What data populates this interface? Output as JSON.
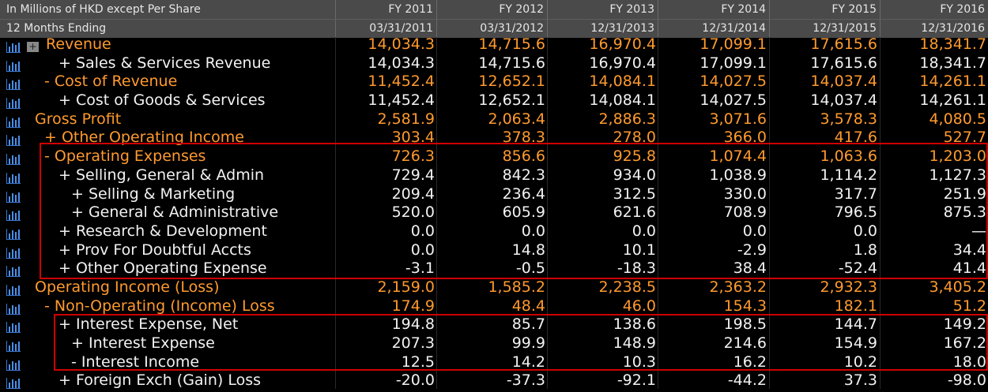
{
  "header": {
    "units": "In Millions of HKD except Per Share",
    "period": "12 Months Ending",
    "years": [
      "FY 2011",
      "FY 2012",
      "FY 2013",
      "FY 2014",
      "FY 2015",
      "FY 2016"
    ],
    "dates": [
      "03/31/2011",
      "03/31/2012",
      "12/31/2013",
      "12/31/2014",
      "12/31/2015",
      "12/31/2016"
    ]
  },
  "rows": [
    {
      "label": "Revenue",
      "indent": 0,
      "prefix": "",
      "color": "orange",
      "expand": true,
      "values": [
        "14,034.3",
        "14,715.6",
        "16,970.4",
        "17,099.1",
        "17,615.6",
        "18,341.7"
      ]
    },
    {
      "label": "+ Sales & Services Revenue",
      "indent": 2,
      "color": "white",
      "values": [
        "14,034.3",
        "14,715.6",
        "16,970.4",
        "17,099.1",
        "17,615.6",
        "18,341.7"
      ]
    },
    {
      "label": "- Cost of Revenue",
      "indent": 1,
      "color": "orange",
      "values": [
        "11,452.4",
        "12,652.1",
        "14,084.1",
        "14,027.5",
        "14,037.4",
        "14,261.1"
      ]
    },
    {
      "label": "+ Cost of Goods & Services",
      "indent": 2,
      "color": "white",
      "values": [
        "11,452.4",
        "12,652.1",
        "14,084.1",
        "14,027.5",
        "14,037.4",
        "14,261.1"
      ]
    },
    {
      "label": "Gross Profit",
      "indent": 0,
      "color": "orange",
      "values": [
        "2,581.9",
        "2,063.4",
        "2,886.3",
        "3,071.6",
        "3,578.3",
        "4,080.5"
      ]
    },
    {
      "label": "+ Other Operating Income",
      "indent": 1,
      "color": "orange",
      "values": [
        "303.4",
        "378.3",
        "278.0",
        "366.0",
        "417.6",
        "527.7"
      ]
    },
    {
      "label": "- Operating Expenses",
      "indent": 1,
      "color": "orange",
      "values": [
        "726.3",
        "856.6",
        "925.8",
        "1,074.4",
        "1,063.6",
        "1,203.0"
      ]
    },
    {
      "label": "+ Selling, General & Admin",
      "indent": 2,
      "color": "white",
      "values": [
        "729.4",
        "842.3",
        "934.0",
        "1,038.9",
        "1,114.2",
        "1,127.3"
      ]
    },
    {
      "label": "+ Selling & Marketing",
      "indent": 3,
      "color": "white",
      "values": [
        "209.4",
        "236.4",
        "312.5",
        "330.0",
        "317.7",
        "251.9"
      ]
    },
    {
      "label": "+ General & Administrative",
      "indent": 3,
      "color": "white",
      "values": [
        "520.0",
        "605.9",
        "621.6",
        "708.9",
        "796.5",
        "875.3"
      ]
    },
    {
      "label": "+ Research & Development",
      "indent": 2,
      "color": "white",
      "values": [
        "0.0",
        "0.0",
        "0.0",
        "0.0",
        "0.0",
        "—"
      ]
    },
    {
      "label": "+ Prov For Doubtful Accts",
      "indent": 2,
      "color": "white",
      "values": [
        "0.0",
        "14.8",
        "10.1",
        "-2.9",
        "1.8",
        "34.4"
      ]
    },
    {
      "label": "+ Other Operating Expense",
      "indent": 2,
      "color": "white",
      "values": [
        "-3.1",
        "-0.5",
        "-18.3",
        "38.4",
        "-52.4",
        "41.4"
      ]
    },
    {
      "label": "Operating Income (Loss)",
      "indent": 0,
      "color": "orange",
      "values": [
        "2,159.0",
        "1,585.2",
        "2,238.5",
        "2,363.2",
        "2,932.3",
        "3,405.2"
      ]
    },
    {
      "label": "- Non-Operating (Income) Loss",
      "indent": 1,
      "color": "orange",
      "values": [
        "174.9",
        "48.4",
        "46.0",
        "154.3",
        "182.1",
        "51.2"
      ]
    },
    {
      "label": "+ Interest Expense, Net",
      "indent": 2,
      "color": "white",
      "values": [
        "194.8",
        "85.7",
        "138.6",
        "198.5",
        "144.7",
        "149.2"
      ]
    },
    {
      "label": "+ Interest Expense",
      "indent": 3,
      "color": "white",
      "values": [
        "207.3",
        "99.9",
        "148.9",
        "214.6",
        "154.9",
        "167.2"
      ]
    },
    {
      "label": "- Interest Income",
      "indent": 3,
      "color": "white",
      "values": [
        "12.5",
        "14.2",
        "10.3",
        "16.2",
        "10.2",
        "18.0"
      ]
    },
    {
      "label": "+ Foreign Exch (Gain) Loss",
      "indent": 2,
      "color": "white",
      "values": [
        "-20.0",
        "-37.3",
        "-92.1",
        "-44.2",
        "37.3",
        "-98.0"
      ]
    }
  ],
  "colors": {
    "accent": "#ff9a2e",
    "text": "#f2f2f2",
    "header_bg": "#4a4a4a",
    "highlight_border": "#d00000",
    "chart_icon": "#3a7bd5"
  },
  "icons": {
    "row_chart": "bar-chart-icon",
    "expand": "expand-plus-icon"
  }
}
